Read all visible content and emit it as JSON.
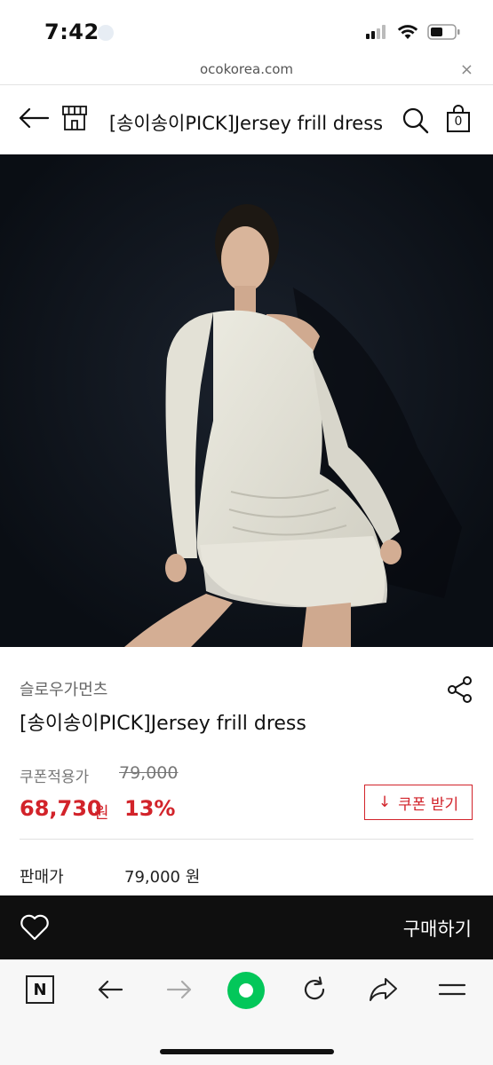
{
  "status_bar": {
    "time": "7:42"
  },
  "browser": {
    "url": "ocokorea.com",
    "close_symbol": "×"
  },
  "header": {
    "title": "[송이송이PICK]Jersey frill dress",
    "bag_count": "0"
  },
  "product": {
    "brand": "슬로우가먼츠",
    "name": "[송이송이PICK]Jersey frill dress",
    "coupon_price_label": "쿠폰적용가",
    "original_price": "79,000",
    "sale_price": "68,730",
    "sale_unit": "원",
    "discount": "13%",
    "coupon_button": {
      "arrow": "↓",
      "label": "쿠폰 받기"
    },
    "sell_label": "판매가",
    "sell_price": "79,000 원"
  },
  "buy_bar": {
    "buy_label": "구매하기"
  },
  "toolbar": {
    "n_label": "N"
  },
  "colors": {
    "accent": "#d2232a",
    "naver_green": "#03c75a",
    "buy_bar": "#0f0f0f"
  }
}
